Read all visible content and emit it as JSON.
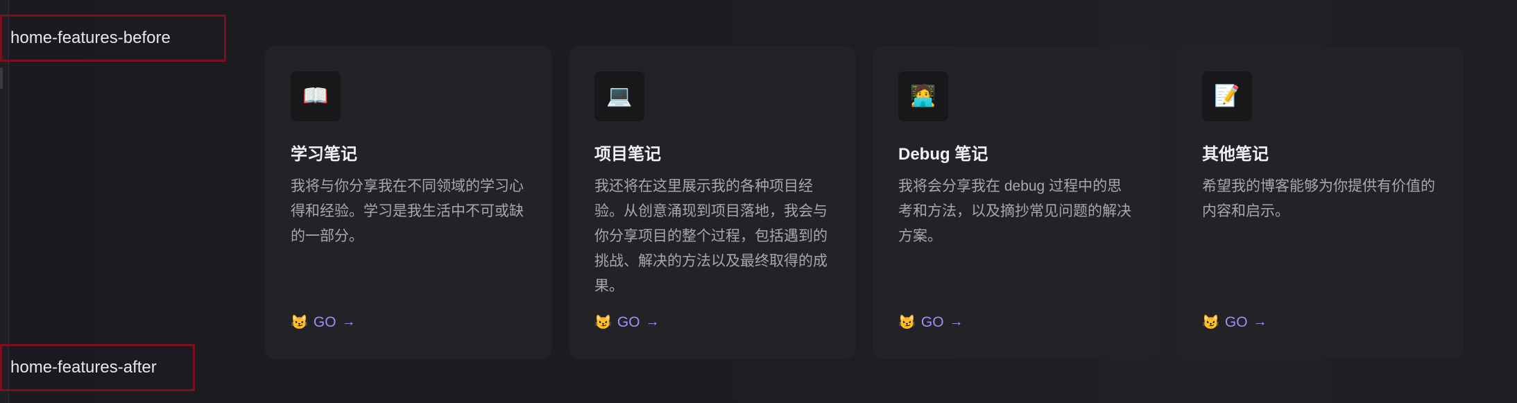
{
  "slots": {
    "before": "home-features-before",
    "after": "home-features-after"
  },
  "features": [
    {
      "icon": "📖",
      "icon_name": "open-book-icon",
      "title": "学习笔记",
      "details": "我将与你分享我在不同领域的学习心得和经验。学习是我生活中不可或缺的一部分。",
      "link_icon": "😼",
      "link_text": "GO",
      "link_arrow": "→"
    },
    {
      "icon": "💻",
      "icon_name": "laptop-icon",
      "title": "项目笔记",
      "details": "我还将在这里展示我的各种项目经验。从创意涌现到项目落地，我会与你分享项目的整个过程，包括遇到的挑战、解决的方法以及最终取得的成果。",
      "link_icon": "😼",
      "link_text": "GO",
      "link_arrow": "→"
    },
    {
      "icon": "🧑‍💻",
      "icon_name": "technologist-icon",
      "title": "Debug 笔记",
      "details": "我将会分享我在 debug 过程中的思考和方法，以及摘抄常见问题的解决方案。",
      "link_icon": "😼",
      "link_text": "GO",
      "link_arrow": "→"
    },
    {
      "icon": "📝",
      "icon_name": "memo-icon",
      "title": "其他笔记",
      "details": "希望我的博客能够为你提供有价值的内容和启示。",
      "link_icon": "😼",
      "link_text": "GO",
      "link_arrow": "→"
    }
  ]
}
